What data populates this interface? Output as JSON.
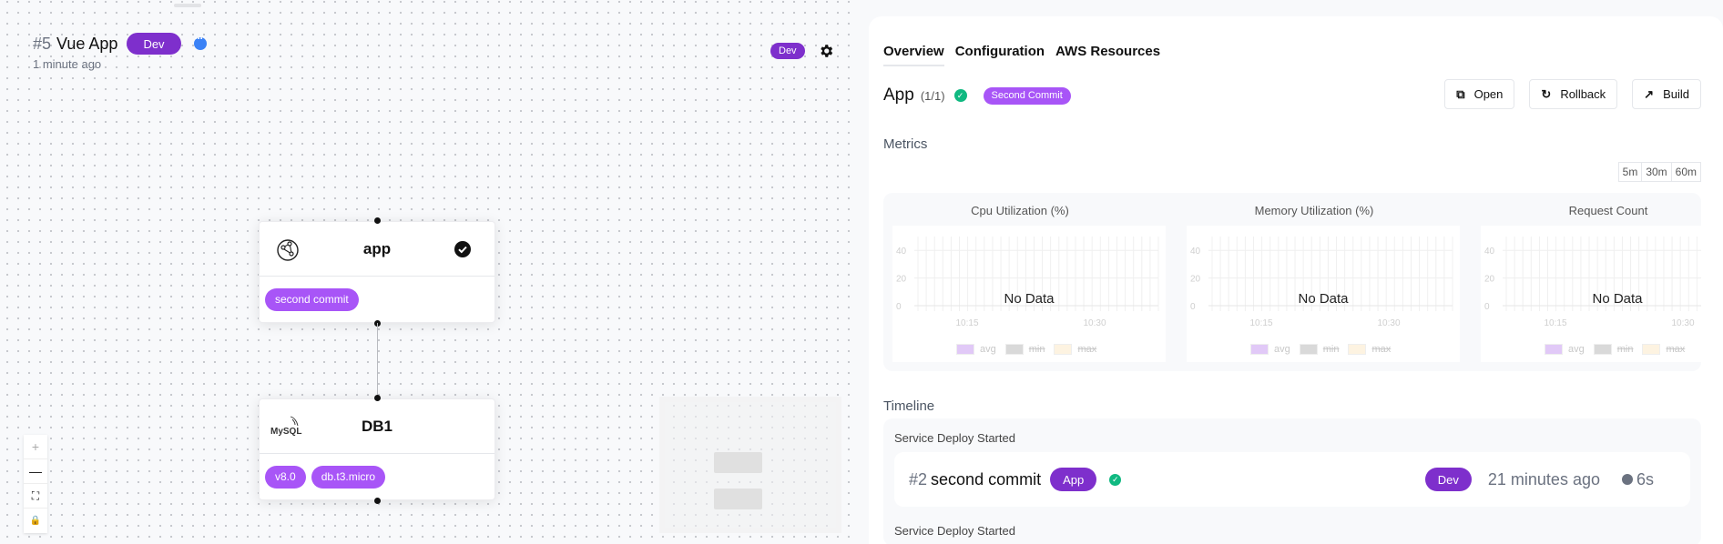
{
  "canvas": {
    "project": {
      "number": "#5",
      "name": "Vue App",
      "environment": "Dev",
      "updated": "1 minute ago"
    },
    "top_env_badge": "Dev",
    "nodes": [
      {
        "id": "app",
        "title": "app",
        "icon": "globe-network-icon",
        "status": "check-circle-icon",
        "tags": [
          "second commit"
        ]
      },
      {
        "id": "db1",
        "title": "DB1",
        "icon": "mysql-logo-icon",
        "tags": [
          "v8.0",
          "db.t3.micro"
        ]
      }
    ],
    "zoom_controls": {
      "zoom_in": "+",
      "zoom_out": "—",
      "fit": "⛶",
      "lock": "🔒"
    }
  },
  "panel": {
    "tabs": [
      {
        "label": "Overview",
        "active": true
      },
      {
        "label": "Configuration",
        "active": false
      },
      {
        "label": "AWS Resources",
        "active": false
      }
    ],
    "service": {
      "name": "App",
      "instances": "(1/1)",
      "status": "healthy",
      "commit_badge": "Second Commit"
    },
    "actions": [
      {
        "label": "Open",
        "icon": "external-link-icon"
      },
      {
        "label": "Rollback",
        "icon": "rollback-icon"
      },
      {
        "label": "Build",
        "icon": "hammer-icon"
      }
    ],
    "metrics": {
      "label": "Metrics",
      "ranges": [
        "5m",
        "30m",
        "60m"
      ]
    },
    "timeline": {
      "label": "Timeline",
      "events": [
        {
          "type": "Service Deploy Started",
          "number": "#2",
          "message": "second commit",
          "service": "App",
          "status": "success",
          "environment": "Dev",
          "ago": "21 minutes ago",
          "duration": "6s"
        },
        {
          "type": "Service Deploy Started"
        }
      ]
    }
  },
  "colors": {
    "env_purple": "#7e2fcc",
    "tag_purple": "#a855f7",
    "success_green": "#10b981",
    "info_blue": "#3b82f6"
  },
  "chart_data": [
    {
      "type": "line",
      "title": "Cpu Utilization (%)",
      "x": [
        "10:15",
        "10:30"
      ],
      "yticks": [
        0,
        20,
        40
      ],
      "ylim": [
        0,
        50
      ],
      "series": [
        {
          "name": "avg",
          "values": [],
          "color": "#e1c9f7",
          "visible": true
        },
        {
          "name": "min",
          "values": [],
          "color": "#d9d9d9",
          "visible": false
        },
        {
          "name": "max",
          "values": [],
          "color": "#fdf3e1",
          "visible": false
        }
      ],
      "empty_message": "No Data",
      "grid": true,
      "legend": "bottom"
    },
    {
      "type": "line",
      "title": "Memory Utilization (%)",
      "x": [
        "10:15",
        "10:30"
      ],
      "yticks": [
        0,
        20,
        40
      ],
      "ylim": [
        0,
        50
      ],
      "series": [
        {
          "name": "avg",
          "values": [],
          "color": "#e1c9f7",
          "visible": true
        },
        {
          "name": "min",
          "values": [],
          "color": "#d9d9d9",
          "visible": false
        },
        {
          "name": "max",
          "values": [],
          "color": "#fdf3e1",
          "visible": false
        }
      ],
      "empty_message": "No Data",
      "grid": true,
      "legend": "bottom"
    },
    {
      "type": "line",
      "title": "Request Count",
      "x": [
        "10:15",
        "10:30"
      ],
      "yticks": [
        0,
        20,
        40
      ],
      "ylim": [
        0,
        50
      ],
      "series": [
        {
          "name": "avg",
          "values": [],
          "color": "#e1c9f7",
          "visible": true
        },
        {
          "name": "min",
          "values": [],
          "color": "#d9d9d9",
          "visible": false
        },
        {
          "name": "max",
          "values": [],
          "color": "#fdf3e1",
          "visible": false
        }
      ],
      "empty_message": "No Data",
      "grid": true,
      "legend": "bottom"
    }
  ]
}
